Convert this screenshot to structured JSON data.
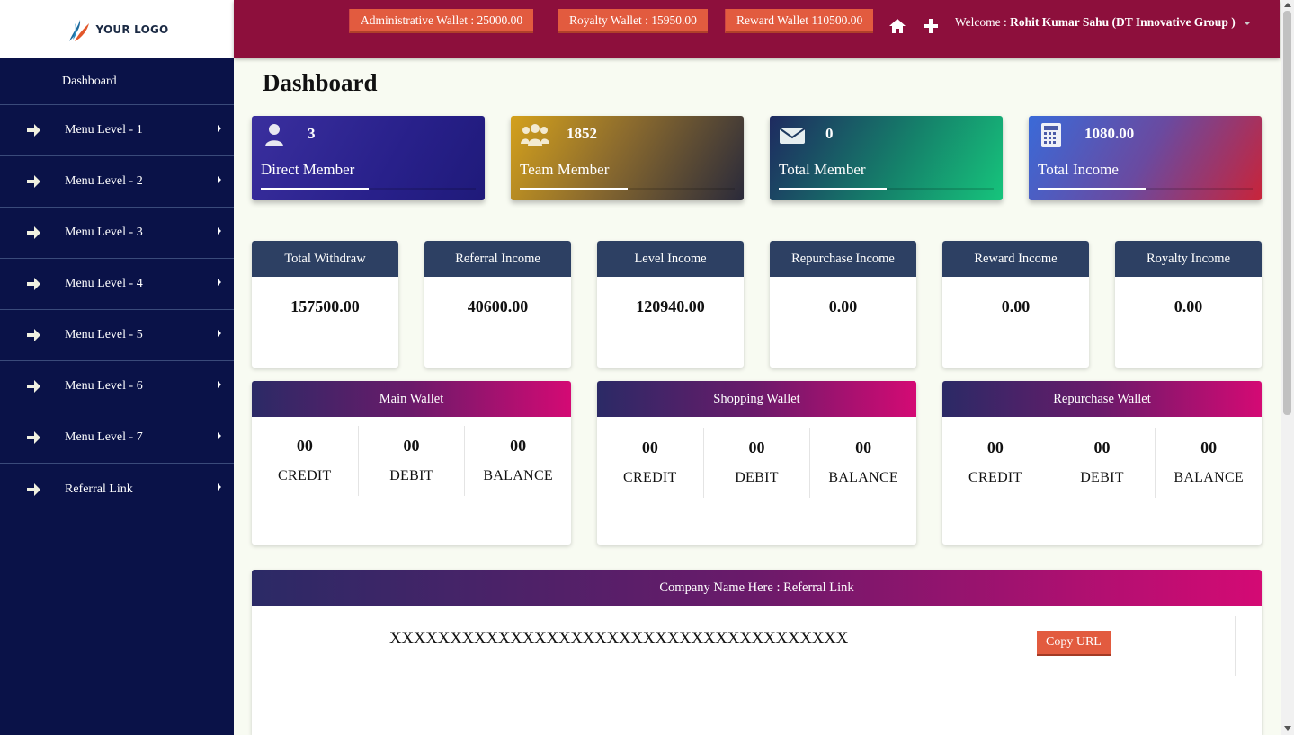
{
  "logo": {
    "text": "YOUR LOGO"
  },
  "sidebar": {
    "dashboard_label": "Dashboard",
    "items": [
      {
        "label": "Menu Level - 1"
      },
      {
        "label": "Menu Level - 2"
      },
      {
        "label": "Menu Level - 3"
      },
      {
        "label": "Menu Level - 4"
      },
      {
        "label": "Menu Level - 5"
      },
      {
        "label": "Menu Level - 6"
      },
      {
        "label": "Menu Level - 7"
      },
      {
        "label": "Referral Link"
      }
    ]
  },
  "topbar": {
    "wallets": [
      {
        "label": "Administrative Wallet : 25000.00"
      },
      {
        "label": "Royalty Wallet : 15950.00"
      },
      {
        "label": "Reward Wallet 110500.00"
      }
    ],
    "welcome_prefix": "Welcome :",
    "user_name": "Rohit Kumar Sahu (DT Innovative Group )"
  },
  "page": {
    "title": "Dashboard"
  },
  "stats": [
    {
      "value": "3",
      "label": "Direct Member",
      "progress": 0.5
    },
    {
      "value": "1852",
      "label": "Team Member",
      "progress": 0.5
    },
    {
      "value": "0",
      "label": "Total Member",
      "progress": 0.5
    },
    {
      "value": "1080.00",
      "label": "Total Income",
      "progress": 0.5
    }
  ],
  "incomes": [
    {
      "title": "Total Withdraw",
      "value": "157500.00"
    },
    {
      "title": "Referral Income",
      "value": "40600.00"
    },
    {
      "title": "Level Income",
      "value": "120940.00"
    },
    {
      "title": "Repurchase Income",
      "value": "0.00"
    },
    {
      "title": "Reward Income",
      "value": "0.00"
    },
    {
      "title": "Royalty Income",
      "value": "0.00"
    }
  ],
  "wallet_cards": [
    {
      "title": "Main Wallet",
      "credit": "00",
      "debit": "00",
      "balance": "00"
    },
    {
      "title": "Shopping Wallet",
      "credit": "00",
      "debit": "00",
      "balance": "00"
    },
    {
      "title": "Repurchase Wallet",
      "credit": "00",
      "debit": "00",
      "balance": "00"
    }
  ],
  "wallet_labels": {
    "credit": "CREDIT",
    "debit": "DEBIT",
    "balance": "BALANCE"
  },
  "referral": {
    "title": "Company Name Here : Referral Link",
    "link": "XXXXXXXXXXXXXXXXXXXXXXXXXXXXXXXXXXXXXX",
    "copy_label": "Copy URL"
  },
  "colors": {
    "sidebar_bg": "#0a1248",
    "topbar_bg": "#8d0f3c",
    "accent_button": "#e25b3f",
    "income_header": "#2d4063"
  },
  "icons": {
    "sidebar_item": "arrow-right-icon",
    "topbar": [
      "home-icon",
      "plus-icon"
    ],
    "stats": [
      "user-icon",
      "users-icon",
      "envelope-icon",
      "calculator-icon"
    ]
  }
}
